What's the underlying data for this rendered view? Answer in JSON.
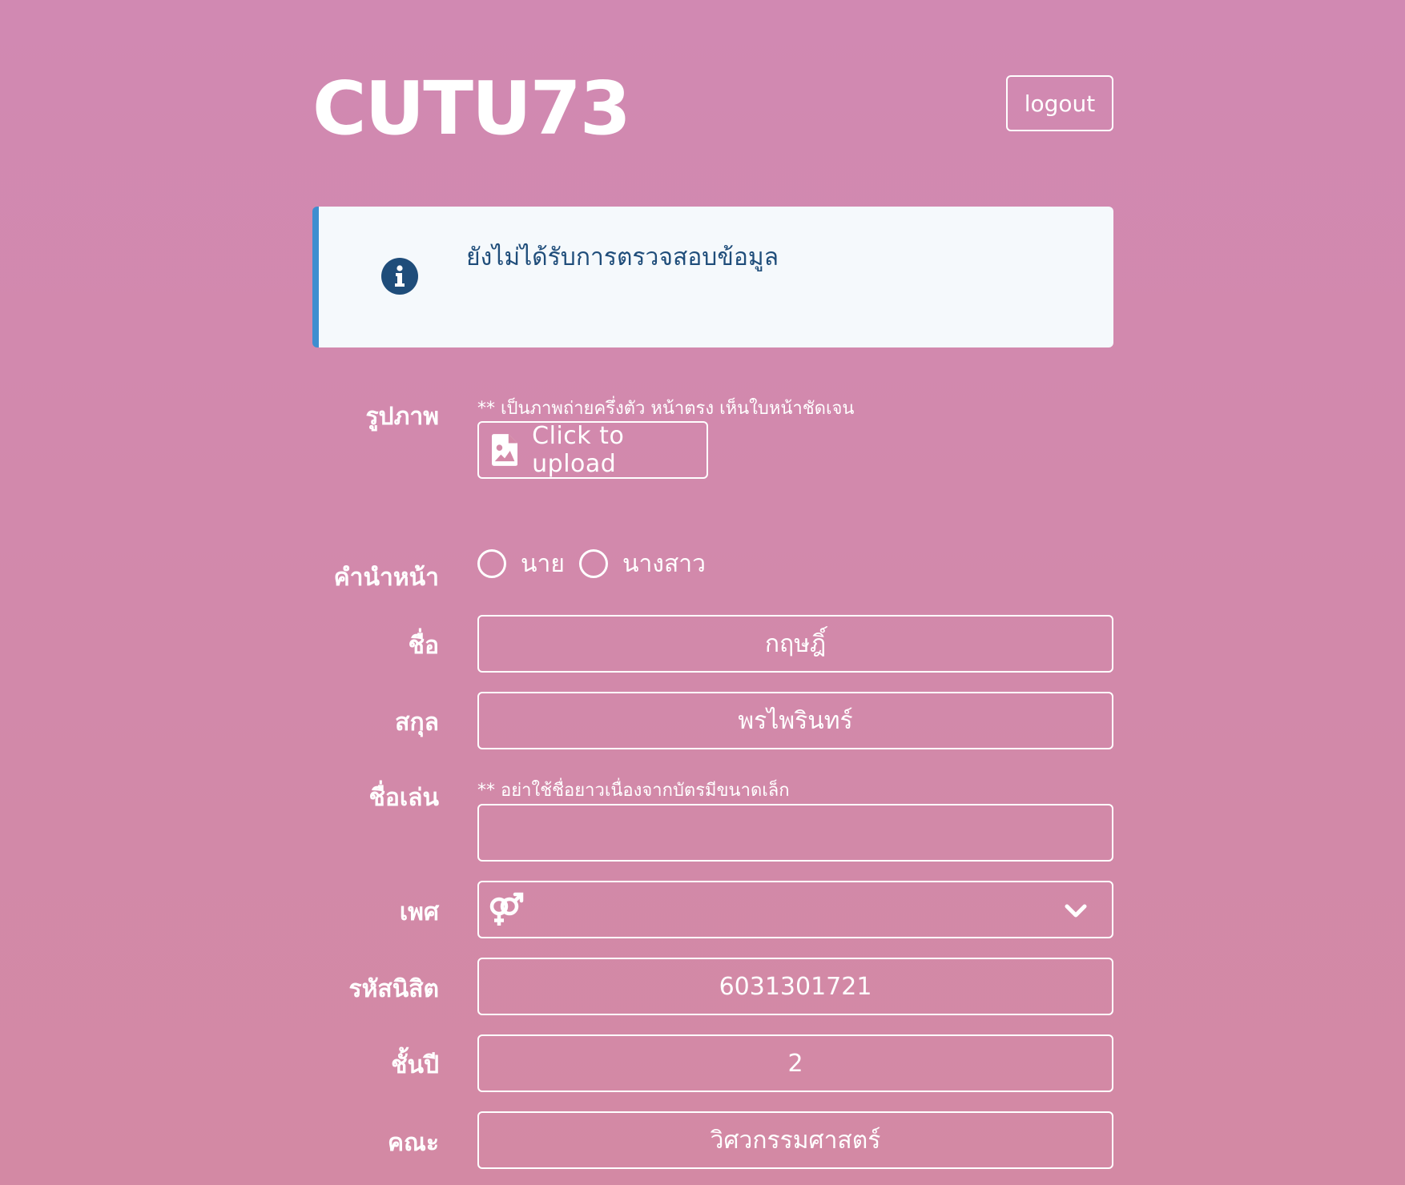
{
  "header": {
    "brand": "CUTU73",
    "logout_label": "logout"
  },
  "notice": {
    "icon": "info-icon",
    "message": "ยังไม่ได้รับการตรวจสอบข้อมูล"
  },
  "form": {
    "photo": {
      "label": "รูปภาพ",
      "hint": "** เป็นภาพถ่ายครึ่งตัว หน้าตรง เห็นใบหน้าชัดเจน",
      "upload_label": "Click to upload",
      "upload_icon": "file-image-icon"
    },
    "title_prefix": {
      "label": "คำนำหน้า",
      "options": [
        "นาย",
        "นางสาว"
      ]
    },
    "first_name": {
      "label": "ชื่อ",
      "value": "กฤษฎิ์"
    },
    "last_name": {
      "label": "สกุล",
      "value": "พรไพรินทร์"
    },
    "nickname": {
      "label": "ชื่อเล่น",
      "hint": "** อย่าใช้ชื่อยาวเนื่องจากบัตรมีขนาดเล็ก",
      "value": ""
    },
    "gender": {
      "label": "เพศ",
      "icon": "venus-mars-icon",
      "value": ""
    },
    "student_id": {
      "label": "รหัสนิสิต",
      "value": "6031301721"
    },
    "year": {
      "label": "ชั้นปี",
      "value": "2"
    },
    "faculty": {
      "label": "คณะ",
      "value": "วิศวกรรมศาสตร์"
    }
  },
  "colors": {
    "background_top": "#d189b2",
    "background_bottom": "#d389a4",
    "notice_bg": "#f5f9fc",
    "notice_accent": "#3e8ed0",
    "notice_text": "#1f4d7a",
    "foreground": "#ffffff"
  }
}
